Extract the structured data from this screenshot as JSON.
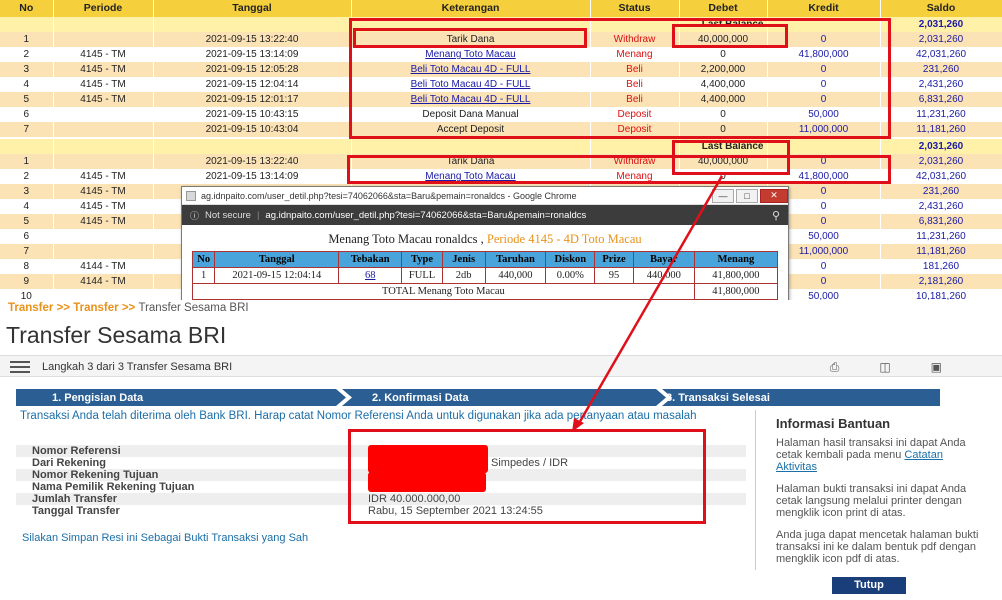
{
  "ledger": {
    "columns": [
      "No",
      "Periode",
      "Tanggal",
      "Keterangan",
      "Status",
      "Debet",
      "Kredit",
      "Saldo"
    ],
    "last_balance_label": "Last Balance",
    "last_balance_value": "2,031,260",
    "rows": [
      {
        "no": "1",
        "periode": "",
        "tanggal": "2021-09-15 13:22:40",
        "keterangan": "Tarik Dana",
        "status": "Withdraw",
        "debet": "40,000,000",
        "kredit": "0",
        "saldo": "2,031,260"
      },
      {
        "no": "2",
        "periode": "4145 - TM",
        "tanggal": "2021-09-15 13:14:09",
        "keterangan": "Menang Toto Macau",
        "status": "Menang",
        "debet": "0",
        "kredit": "41,800,000",
        "saldo": "42,031,260"
      },
      {
        "no": "3",
        "periode": "4145 - TM",
        "tanggal": "2021-09-15 12:05:28",
        "keterangan": "Beli Toto Macau 4D - FULL",
        "status": "Beli",
        "debet": "2,200,000",
        "kredit": "0",
        "saldo": "231,260"
      },
      {
        "no": "4",
        "periode": "4145 - TM",
        "tanggal": "2021-09-15 12:04:14",
        "keterangan": "Beli Toto Macau 4D - FULL",
        "status": "Beli",
        "debet": "4,400,000",
        "kredit": "0",
        "saldo": "2,431,260"
      },
      {
        "no": "5",
        "periode": "4145 - TM",
        "tanggal": "2021-09-15 12:01:17",
        "keterangan": "Beli Toto Macau 4D - FULL",
        "status": "Beli",
        "debet": "4,400,000",
        "kredit": "0",
        "saldo": "6,831,260"
      },
      {
        "no": "6",
        "periode": "",
        "tanggal": "2021-09-15 10:43:15",
        "keterangan": "Deposit Dana Manual",
        "status": "Deposit",
        "debet": "0",
        "kredit": "50,000",
        "saldo": "11,231,260"
      },
      {
        "no": "7",
        "periode": "",
        "tanggal": "2021-09-15 10:43:04",
        "keterangan": "Accept Deposit",
        "status": "Deposit",
        "debet": "0",
        "kredit": "11,000,000",
        "saldo": "11,181,260"
      }
    ],
    "rows2": [
      {
        "no": "1",
        "periode": "",
        "tanggal": "2021-09-15 13:22:40",
        "keterangan": "Tarik Dana",
        "status": "Withdraw",
        "debet": "40,000,000",
        "kredit": "0",
        "saldo": "2,031,260"
      },
      {
        "no": "2",
        "periode": "4145 - TM",
        "tanggal": "2021-09-15 13:14:09",
        "keterangan": "Menang Toto Macau",
        "status": "Menang",
        "debet": "0",
        "kredit": "41,800,000",
        "saldo": "42,031,260"
      },
      {
        "no": "3",
        "periode": "4145 - TM",
        "tanggal": "",
        "keterangan": "",
        "status": "",
        "debet": "",
        "kredit": "0",
        "saldo": "231,260"
      },
      {
        "no": "4",
        "periode": "4145 - TM",
        "tanggal": "",
        "keterangan": "",
        "status": "",
        "debet": "",
        "kredit": "0",
        "saldo": "2,431,260"
      },
      {
        "no": "5",
        "periode": "4145 - TM",
        "tanggal": "",
        "keterangan": "",
        "status": "",
        "debet": "",
        "kredit": "0",
        "saldo": "6,831,260"
      },
      {
        "no": "6",
        "periode": "",
        "tanggal": "",
        "keterangan": "",
        "status": "",
        "debet": "",
        "kredit": "50,000",
        "saldo": "11,231,260"
      },
      {
        "no": "7",
        "periode": "",
        "tanggal": "",
        "keterangan": "",
        "status": "",
        "debet": "",
        "kredit": "11,000,000",
        "saldo": "11,181,260"
      },
      {
        "no": "8",
        "periode": "4144 - TM",
        "tanggal": "",
        "keterangan": "",
        "status": "",
        "debet": "",
        "kredit": "0",
        "saldo": "181,260"
      },
      {
        "no": "9",
        "periode": "4144 - TM",
        "tanggal": "",
        "keterangan": "",
        "status": "",
        "debet": "",
        "kredit": "0",
        "saldo": "2,181,260"
      },
      {
        "no": "10",
        "periode": "",
        "tanggal": "",
        "keterangan": "",
        "status": "",
        "debet": "",
        "kredit": "50,000",
        "saldo": "10,181,260"
      }
    ]
  },
  "popup": {
    "window_title": "ag.idnpaito.com/user_detil.php?tesi=74062066&sta=Baru&pemain=ronaldcs - Google Chrome",
    "not_secure": "Not secure",
    "url": "ag.idnpaito.com/user_detil.php?tesi=74062066&sta=Baru&pemain=ronaldcs",
    "heading": "Menang Toto Macau ronaldcs ,",
    "heading_period": "Periode 4145 - 4D Toto Macau",
    "columns": [
      "No",
      "Tanggal",
      "Tebakan",
      "Type",
      "Jenis",
      "Taruhan",
      "Diskon",
      "Prize",
      "Bayar",
      "Menang"
    ],
    "row": {
      "no": "1",
      "tanggal": "2021-09-15 12:04:14",
      "tebakan": "68",
      "type": "FULL",
      "jenis": "2db",
      "taruhan": "440,000",
      "diskon": "0.00%",
      "prize": "95",
      "bayar": "440,000",
      "menang": "41,800,000"
    },
    "total_label": "TOTAL  Menang Toto Macau",
    "total_value": "41,800,000"
  },
  "bri": {
    "crumb1": "Transfer",
    "crumb2": "Transfer",
    "crumb3": "Transfer Sesama BRI",
    "title": "Transfer Sesama BRI",
    "step_label": "Langkah 3 dari 3 Transfer Sesama BRI",
    "steps": [
      "1. Pengisian Data",
      "2. Konfirmasi Data",
      "3. Transaksi Selesai"
    ],
    "message": "Transaksi Anda telah diterima oleh Bank BRI. Harap catat Nomor Referensi Anda untuk digunakan jika ada pertanyaan atau masalah",
    "fields": [
      {
        "label": "Nomor Referensi",
        "value": ""
      },
      {
        "label": "Dari Rekening",
        "value": "Simpedes / IDR"
      },
      {
        "label": "Nomor Rekening Tujuan",
        "value": ""
      },
      {
        "label": "Nama Pemilik Rekening Tujuan",
        "value": ""
      },
      {
        "label": "Jumlah Transfer",
        "value": "IDR 40.000.000,00"
      },
      {
        "label": "Tanggal Transfer",
        "value": "Rabu, 15 September 2021 13:24:55"
      }
    ],
    "save_note": "Silakan Simpan Resi ini Sebagai Bukti Transaksi yang Sah",
    "help_title": "Informasi Bantuan",
    "help_p1": "Halaman hasil transaksi ini dapat Anda cetak kembali pada menu",
    "help_p1_link": "Catatan Aktivitas",
    "help_p2": "Halaman bukti transaksi ini dapat Anda cetak langsung melalui printer dengan mengklik icon print di atas.",
    "help_p3": "Anda juga dapat mencetak halaman bukti transaksi ini ke dalam bentuk pdf dengan mengklik icon pdf di atas.",
    "close_button": "Tutup"
  },
  "colors": {
    "annotation": "#e0101a",
    "header_gold": "#f6cf3c",
    "row_peach": "#fbe3b6",
    "link_blue": "#1a1aa6",
    "bri_navy": "#1a3e7a",
    "step_blue": "#2b5f93"
  }
}
